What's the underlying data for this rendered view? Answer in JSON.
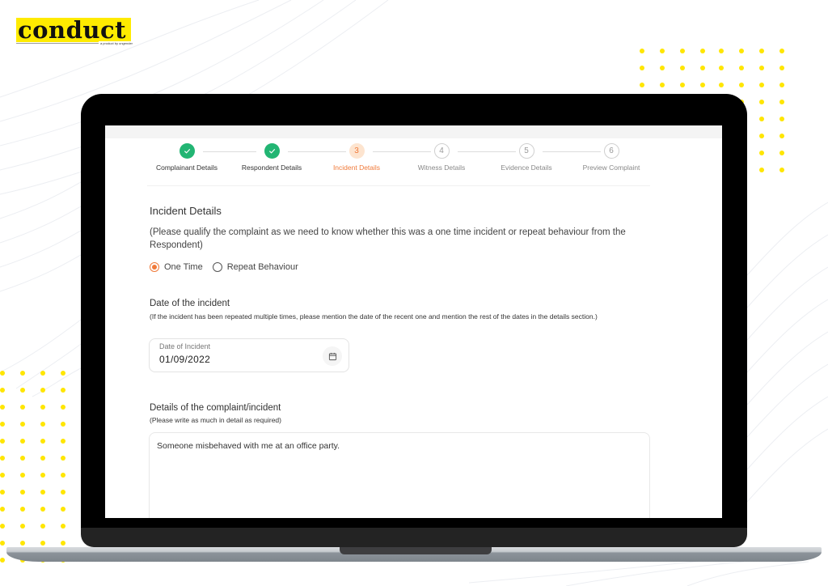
{
  "brand": {
    "name": "conduct",
    "tagline": "a product by ungender",
    "accent_color": "#ffeb00"
  },
  "stepper": {
    "steps": [
      {
        "number": "1",
        "label": "Complainant Details",
        "status": "done",
        "icon": "check-icon"
      },
      {
        "number": "2",
        "label": "Respondent Details",
        "status": "done",
        "icon": "check-icon"
      },
      {
        "number": "3",
        "label": "Incident Details",
        "status": "active"
      },
      {
        "number": "4",
        "label": "Witness Details",
        "status": "pending"
      },
      {
        "number": "5",
        "label": "Evidence Details",
        "status": "pending"
      },
      {
        "number": "6",
        "label": "Preview Complaint",
        "status": "pending"
      }
    ],
    "colors": {
      "done": "#22b573",
      "active": "#f07a3a",
      "pending": "#999999"
    }
  },
  "form": {
    "section_title": "Incident Details",
    "qualify_text": "(Please qualify the complaint as we need to know whether this was a one time incident or repeat behaviour from the Respondent)",
    "incident_type": {
      "options": [
        "One Time",
        "Repeat Behaviour"
      ],
      "selected": "One Time"
    },
    "date": {
      "title": "Date of the incident",
      "help": "(If the incident has been repeated multiple times, please mention the date of the recent one and mention the rest of the dates in the details section.)",
      "field_label": "Date of Incident",
      "value": "01/09/2022",
      "icon": "calendar-icon"
    },
    "details": {
      "title": "Details of the complaint/incident",
      "help": "(Please write as much in detail as required)",
      "value": "Someone misbehaved with me at an office party."
    }
  }
}
